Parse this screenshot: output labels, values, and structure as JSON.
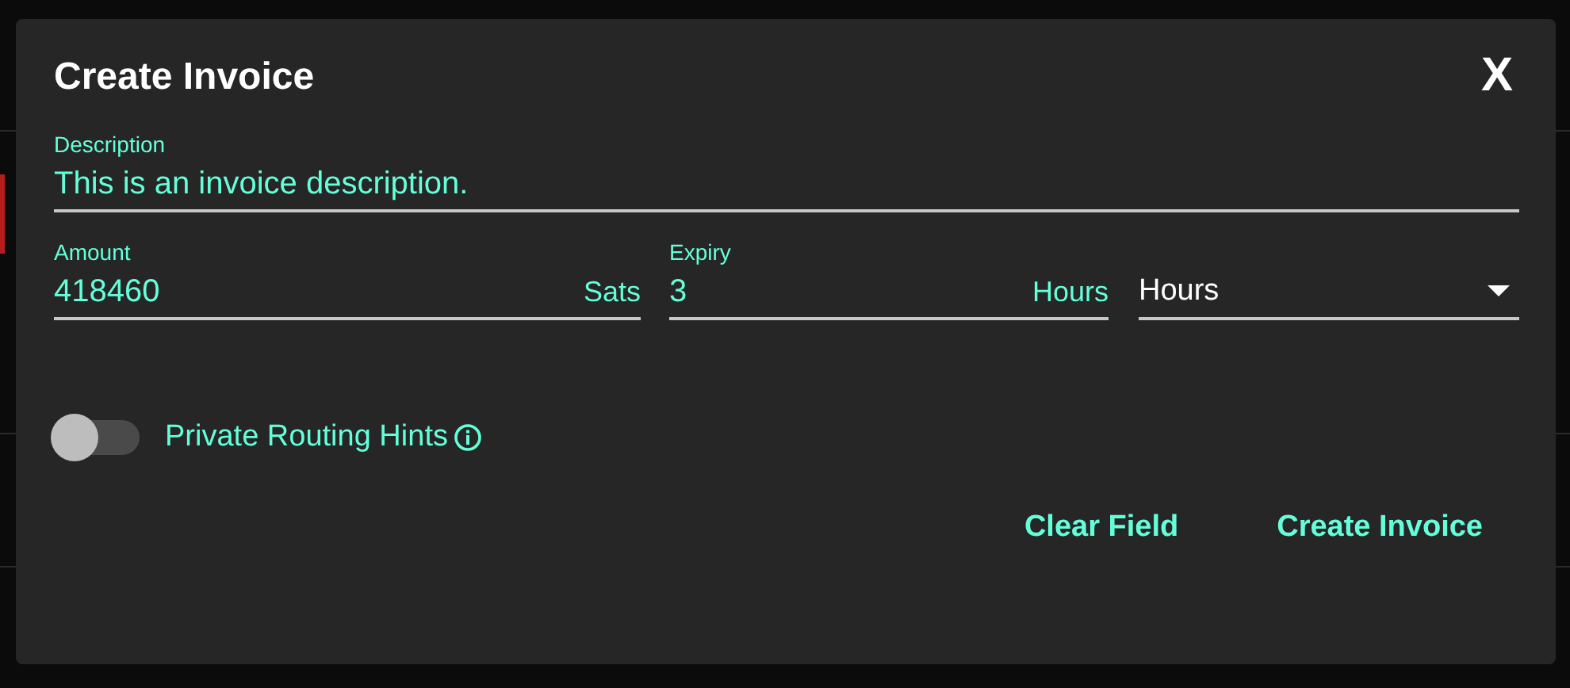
{
  "dialog": {
    "title": "Create Invoice",
    "close": "X",
    "description": {
      "label": "Description",
      "value": "This is an invoice description."
    },
    "amount": {
      "label": "Amount",
      "value": "418460",
      "unit": "Sats"
    },
    "expiry": {
      "label": "Expiry",
      "value": "3",
      "unit": "Hours"
    },
    "expiry_unit": {
      "value": "Hours"
    },
    "private_routing_hints": {
      "label": "Private Routing Hints",
      "on": false
    },
    "buttons": [
      "Clear Field",
      "Create Invoice"
    ]
  }
}
